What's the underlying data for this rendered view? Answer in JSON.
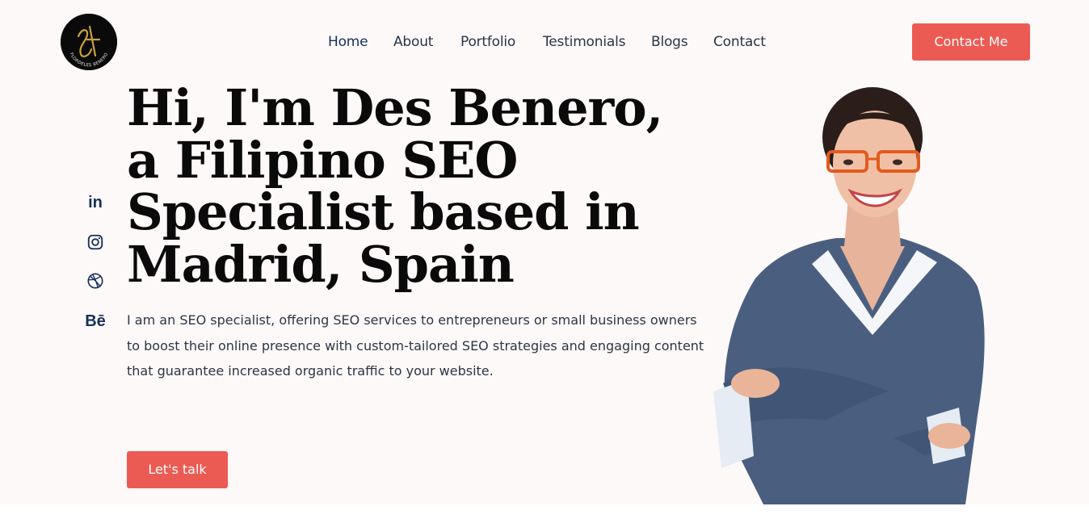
{
  "brand": {
    "logo_letter": "F",
    "logo_text": "FLORDELES BENERO",
    "colors": {
      "accent": "#ec5b53",
      "nav_active": "#14305c",
      "heading": "#0a0a0a",
      "background": "#fdf9f8"
    }
  },
  "nav": {
    "items": [
      {
        "label": "Home"
      },
      {
        "label": "About"
      },
      {
        "label": "Portfolio"
      },
      {
        "label": "Testimonials"
      },
      {
        "label": "Blogs"
      },
      {
        "label": "Contact"
      }
    ],
    "active": "Home"
  },
  "header": {
    "cta_label": "Contact Me"
  },
  "social": [
    {
      "icon": "linkedin-icon",
      "text": "in"
    },
    {
      "icon": "instagram-icon"
    },
    {
      "icon": "dribbble-icon"
    },
    {
      "icon": "behance-icon",
      "text": "Bē"
    }
  ],
  "hero": {
    "headline_lines": [
      "Hi, I'm Des Benero,",
      "a Filipino SEO",
      "Specialist based in",
      "Madrid, Spain"
    ],
    "intro_lines": [
      "I am an SEO specialist, offering SEO services to entrepreneurs or small business owners",
      "to boost their online presence with custom-tailored SEO strategies and engaging content",
      "that guarantee increased organic traffic to your website."
    ],
    "cta_label": "Let's talk"
  }
}
